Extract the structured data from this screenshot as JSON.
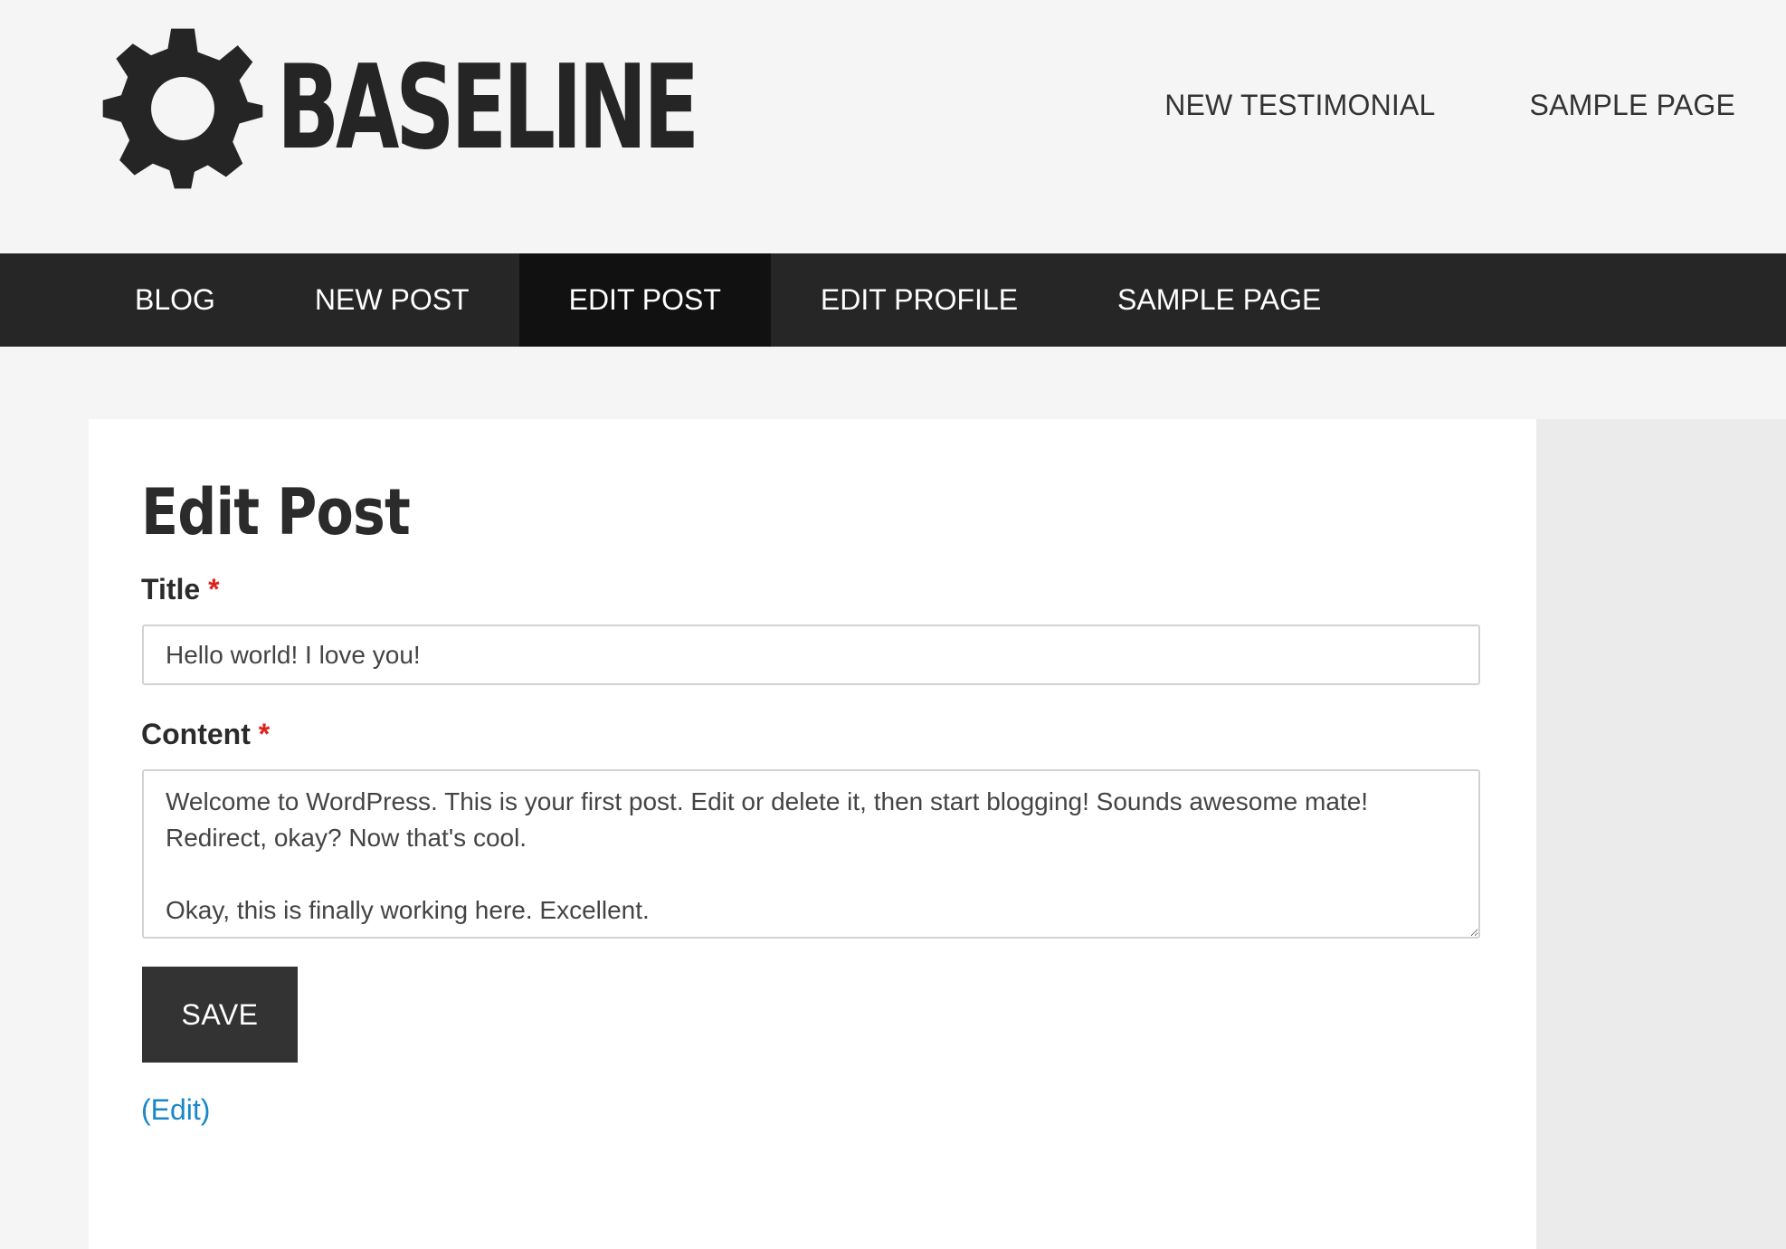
{
  "site": {
    "logo_text": "BASELINE",
    "logo_icon": "gear-icon"
  },
  "header_nav": {
    "items": [
      {
        "label": "NEW TESTIMONIAL"
      },
      {
        "label": "SAMPLE PAGE"
      }
    ]
  },
  "main_nav": {
    "items": [
      {
        "label": "BLOG",
        "active": false
      },
      {
        "label": "NEW POST",
        "active": false
      },
      {
        "label": "EDIT POST",
        "active": true
      },
      {
        "label": "EDIT PROFILE",
        "active": false
      },
      {
        "label": "SAMPLE PAGE",
        "active": false
      }
    ]
  },
  "form": {
    "page_title": "Edit Post",
    "title_label": "Title",
    "title_value": "Hello world! I love you!",
    "content_label": "Content",
    "content_value": "Welcome to WordPress. This is your first post. Edit or delete it, then start blogging! Sounds awesome mate! Redirect, okay? Now that's cool.\n\nOkay, this is finally working here. Excellent.",
    "required_mark": "*",
    "save_label": "SAVE",
    "edit_link": "(Edit)"
  },
  "colors": {
    "background": "#f5f5f5",
    "nav_bg": "#262626",
    "nav_active_bg": "#111111",
    "required": "#e0201c",
    "link": "#1a87c8",
    "button_bg": "#333333"
  }
}
